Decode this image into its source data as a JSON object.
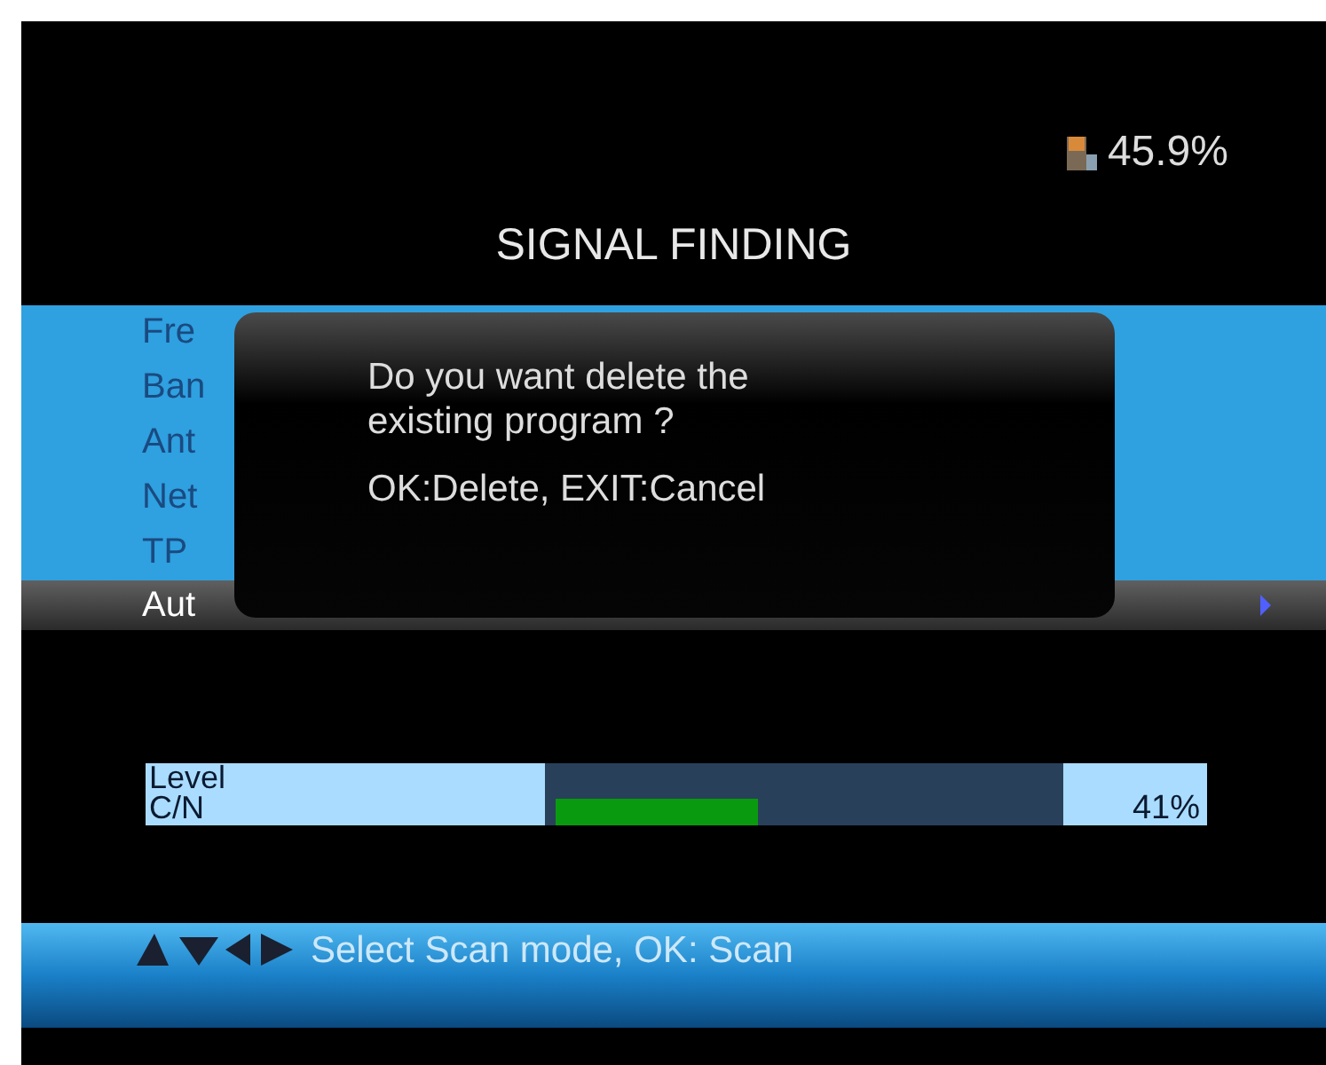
{
  "signal": {
    "reading": "45.9%"
  },
  "title": "SIGNAL FINDING",
  "menu": [
    {
      "label": "Fre",
      "selected": false
    },
    {
      "label": "Ban",
      "selected": false
    },
    {
      "label": "Ant",
      "selected": false
    },
    {
      "label": "Net",
      "selected": false
    },
    {
      "label": "TP",
      "selected": false
    },
    {
      "label": "Aut",
      "selected": true
    }
  ],
  "dialog": {
    "message": "Do you want delete the existing program ?",
    "hint": "OK:Delete, EXIT:Cancel"
  },
  "meters": [
    {
      "name": "Level"
    },
    {
      "name": "C/N",
      "level": 0.4,
      "reading": "41%"
    }
  ],
  "help": "Select Scan mode, OK: Scan"
}
